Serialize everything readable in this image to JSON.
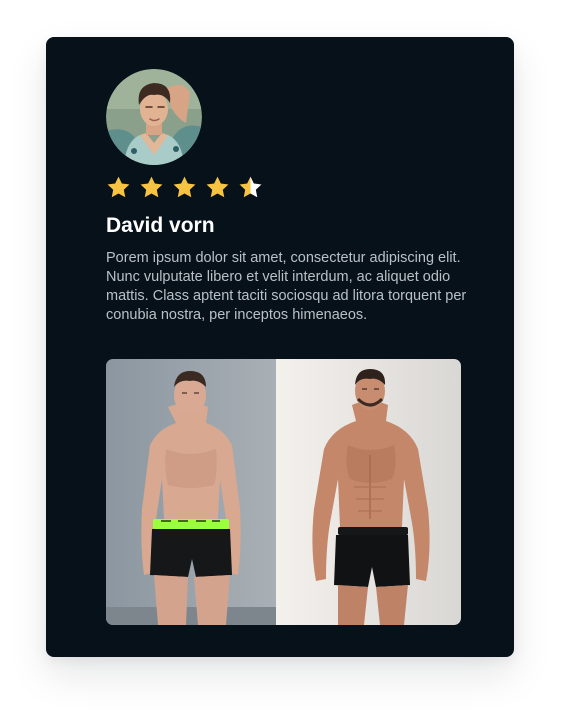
{
  "review_card": {
    "reviewer_name": "David vorn",
    "rating": 4.5,
    "rating_max": 5,
    "review_text": "Porem ipsum dolor sit amet, consectetur adipiscing elit. Nunc vulputate libero et velit interdum, ac aliquet odio mattis. Class aptent taciti sociosqu ad litora torquent per conubia nostra, per inceptos himenaeos.",
    "icons": {
      "star": "star-icon"
    },
    "colors": {
      "card_background": "#07111a",
      "star_fill": "#f7c343",
      "star_empty": "#ffffff",
      "name_text": "#ffffff",
      "body_text": "#b9c0c7"
    }
  }
}
